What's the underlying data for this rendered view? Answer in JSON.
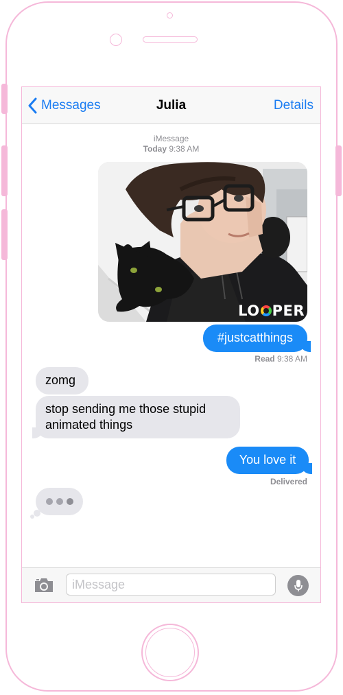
{
  "nav": {
    "back_label": "Messages",
    "title": "Julia",
    "details_label": "Details"
  },
  "thread_header": {
    "service": "iMessage",
    "day": "Today",
    "time": "9:38 AM"
  },
  "photo": {
    "watermark_left": "LO",
    "watermark_right": "PER"
  },
  "messages": [
    {
      "from": "me",
      "text": "#justcatthings"
    },
    {
      "from": "them",
      "text": "zomg"
    },
    {
      "from": "them",
      "text": "stop sending me those stupid animated things"
    },
    {
      "from": "me",
      "text": "You love it"
    }
  ],
  "receipts": {
    "read_label": "Read",
    "read_time": "9:38 AM",
    "delivered": "Delivered"
  },
  "composer": {
    "placeholder": "iMessage"
  },
  "colors": {
    "accent": "#1a7cf2",
    "outgoing_bubble": "#1a8bf7",
    "incoming_bubble": "#e6e6eb",
    "frame": "#f5b8d9"
  },
  "icons": [
    "chevron-left-icon",
    "camera-icon",
    "microphone-icon",
    "typing-indicator-icon"
  ]
}
